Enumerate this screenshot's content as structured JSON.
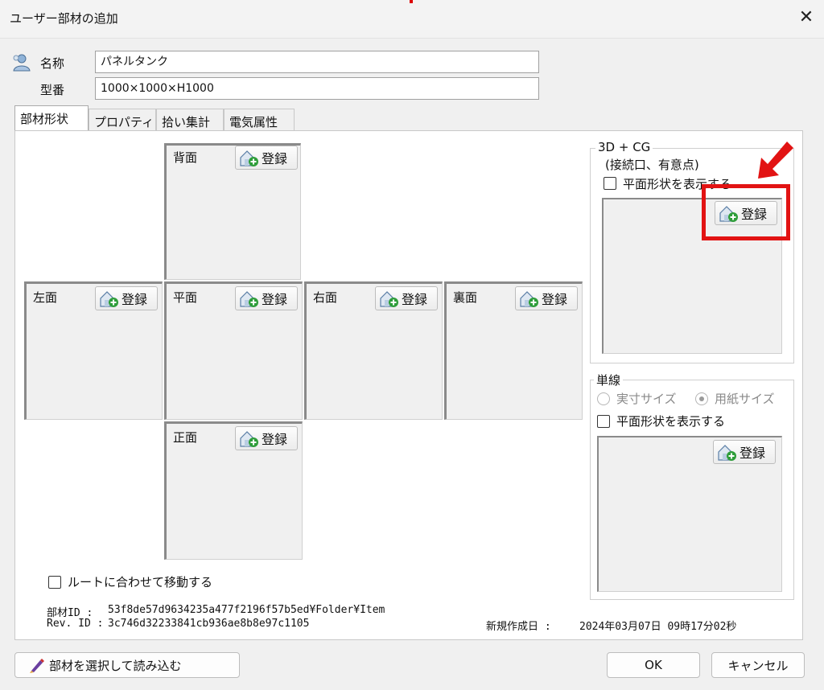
{
  "window": {
    "title": "ユーザー部材の追加",
    "close_glyph": "✕"
  },
  "fields": {
    "name_label": "名称",
    "name_value": "パネルタンク",
    "model_label": "型番",
    "model_value": "1000×1000×H1000"
  },
  "tabs": [
    "部材形状",
    "プロパティ",
    "拾い集計",
    "電気属性"
  ],
  "register_label": "登録",
  "views": {
    "back": "背面",
    "left": "左面",
    "plan": "平面",
    "right": "右面",
    "rear": "裏面",
    "front": "正面"
  },
  "cg_group": {
    "legend": "3D + CG",
    "subtitle": "(接続口、有意点)",
    "show_plan_label": "平面形状を表示する"
  },
  "single_line_group": {
    "legend": "単線",
    "radio_actual": "実寸サイズ",
    "radio_paper": "用紙サイズ",
    "show_plan_label": "平面形状を表示する"
  },
  "route_checkbox_label": "ルートに合わせて移動する",
  "info": {
    "part_id_label": "部材ID :",
    "part_id_value": "53f8de57d9634235a477f2196f57b5ed¥Folder¥Item",
    "rev_id_label": "Rev. ID :",
    "rev_id_value": "3c746d32233841cb936ae8b8e97c1105",
    "created_label": "新規作成日 :",
    "created_value": "2024年03月07日 09時17分02秒"
  },
  "buttons": {
    "load": "部材を選択して読み込む",
    "ok": "OK",
    "cancel": "キャンセル"
  },
  "colors": {
    "highlight": "#e21313",
    "icon_green": "#2e9d3a"
  }
}
